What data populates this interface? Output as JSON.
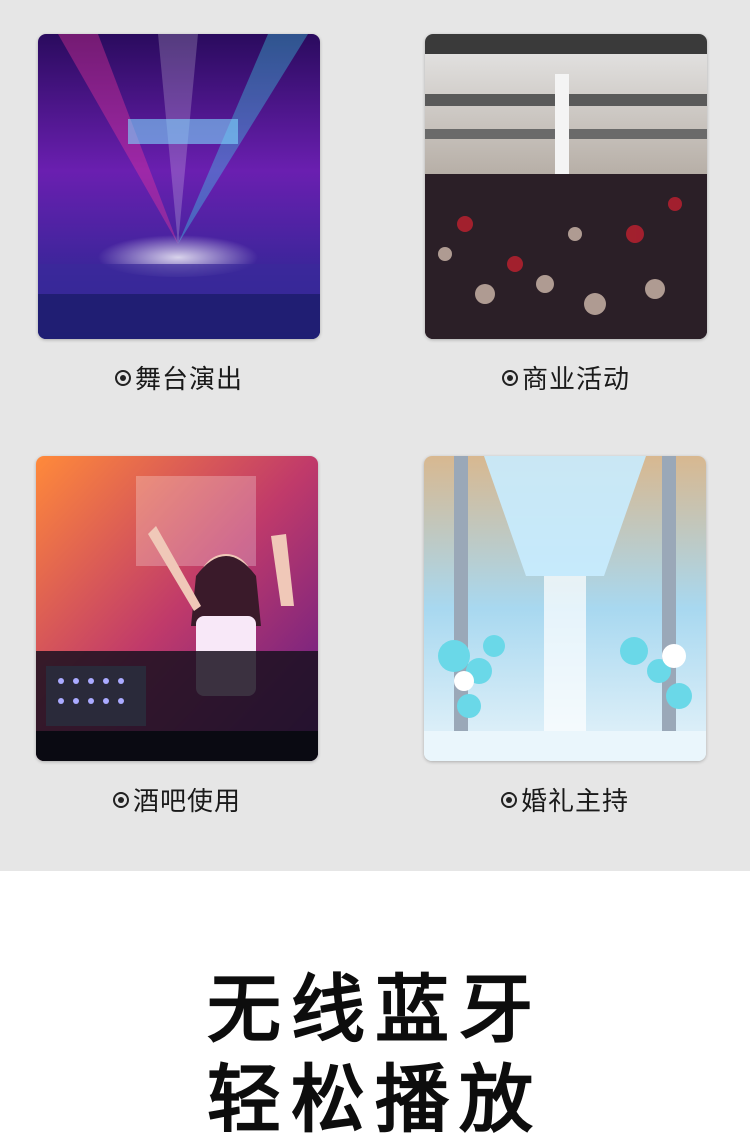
{
  "scenarios": [
    {
      "label": "舞台演出",
      "image": "concert-stage-photo"
    },
    {
      "label": "商业活动",
      "image": "mall-crowd-photo"
    },
    {
      "label": "酒吧使用",
      "image": "dj-bar-photo"
    },
    {
      "label": "婚礼主持",
      "image": "wedding-stage-photo"
    }
  ],
  "headline": {
    "line1": "无线蓝牙",
    "line2": "轻松播放"
  },
  "colors": {
    "panel_bg": "#e6e6e6",
    "page_bg": "#ffffff",
    "text": "#0d0d0d"
  }
}
